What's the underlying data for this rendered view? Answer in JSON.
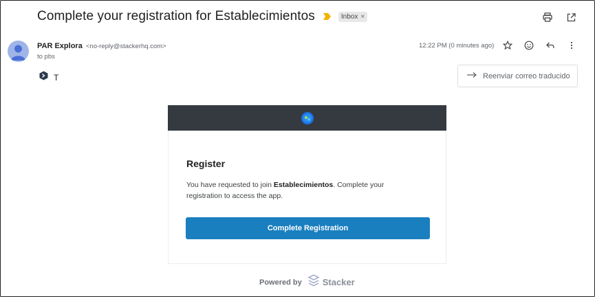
{
  "email": {
    "subject": "Complete your registration for Establecimientos",
    "label": "Inbox",
    "label_close": "×",
    "sender_name": "PAR Explora",
    "sender_email": "<no-reply@stackerhq.com>",
    "to": "to pbs",
    "time": "12:22 PM (0 minutes ago)",
    "translate_char": "T",
    "forward_label": "Reenviar correo traducido"
  },
  "card": {
    "title": "Register",
    "text_prefix": "You have requested to join ",
    "app_name": "Establecimientos",
    "text_suffix": ". Complete your registration to access the app.",
    "button_label": "Complete Registration"
  },
  "footer": {
    "powered_by": "Powered by",
    "brand": "Stacker"
  },
  "colors": {
    "header_bg": "#343a3f",
    "cta_bg": "#1a7fbf",
    "important": "#f4b400"
  },
  "icons": [
    "important-marker-icon",
    "print-icon",
    "open-new-window-icon",
    "star-icon",
    "emoji-icon",
    "reply-icon",
    "more-icon",
    "translate-icon",
    "arrow-right-icon",
    "stacker-logo-icon"
  ]
}
